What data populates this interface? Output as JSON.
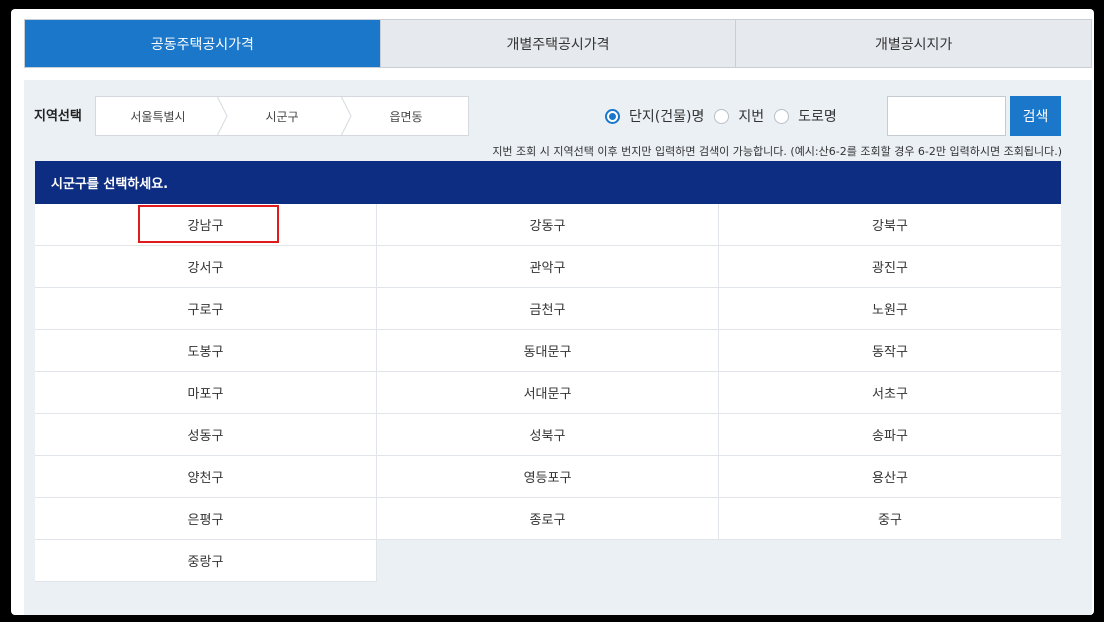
{
  "tabs": [
    "공동주택공시가격",
    "개별주택공시가격",
    "개별공시지가"
  ],
  "region": {
    "label": "지역선택",
    "crumbs": [
      "서울특별시",
      "시군구",
      "읍면동"
    ]
  },
  "search_type": {
    "options": [
      "단지(건물)명",
      "지번",
      "도로명"
    ],
    "selected": "단지(건물)명"
  },
  "search": {
    "value": "",
    "button": "검색"
  },
  "notice": "지번 조회 시 지역선택 이후 번지만 입력하면 검색이 가능합니다. (예시:산6-2를 조회할 경우 6-2만 입력하시면 조회됩니다.)",
  "district_header": "시군구를 선택하세요.",
  "districts": [
    "강남구",
    "강동구",
    "강북구",
    "강서구",
    "관악구",
    "광진구",
    "구로구",
    "금천구",
    "노원구",
    "도봉구",
    "동대문구",
    "동작구",
    "마포구",
    "서대문구",
    "서초구",
    "성동구",
    "성북구",
    "송파구",
    "양천구",
    "영등포구",
    "용산구",
    "은평구",
    "종로구",
    "중구",
    "중랑구"
  ],
  "highlighted_district": "강남구",
  "colors": {
    "accent": "#1a77c9",
    "header": "#0c2d82",
    "highlight": "#e01b1b",
    "panel": "#ebf0f5"
  }
}
